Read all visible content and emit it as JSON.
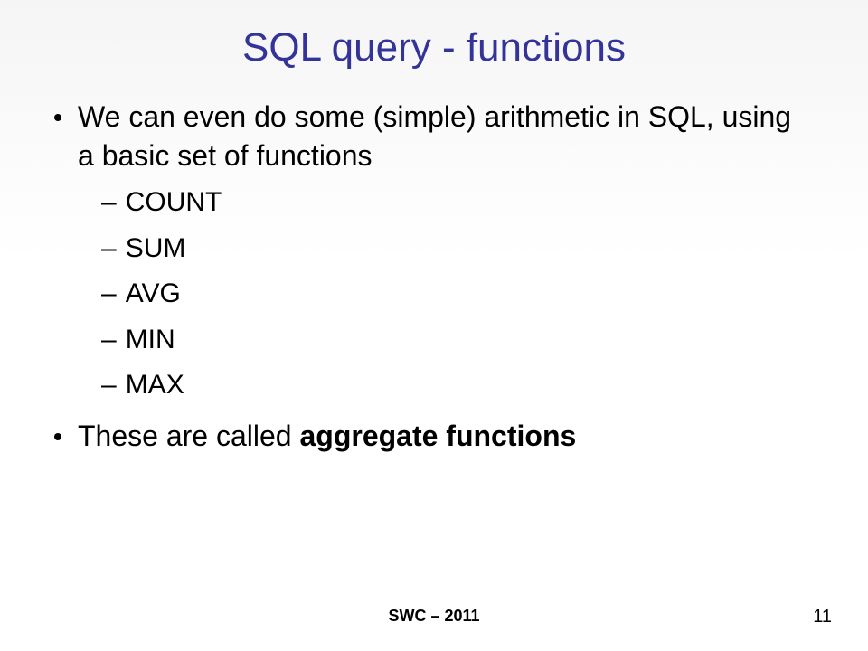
{
  "title": "SQL query - functions",
  "bullets": [
    {
      "text": "We can even do some (simple) arithmetic in SQL, using a basic set of functions",
      "sub": [
        "COUNT",
        "SUM",
        "AVG",
        "MIN",
        "MAX"
      ]
    },
    {
      "text_prefix": "These are called ",
      "text_bold": "aggregate functions"
    }
  ],
  "footer": "SWC – 2011",
  "page_number": "11"
}
